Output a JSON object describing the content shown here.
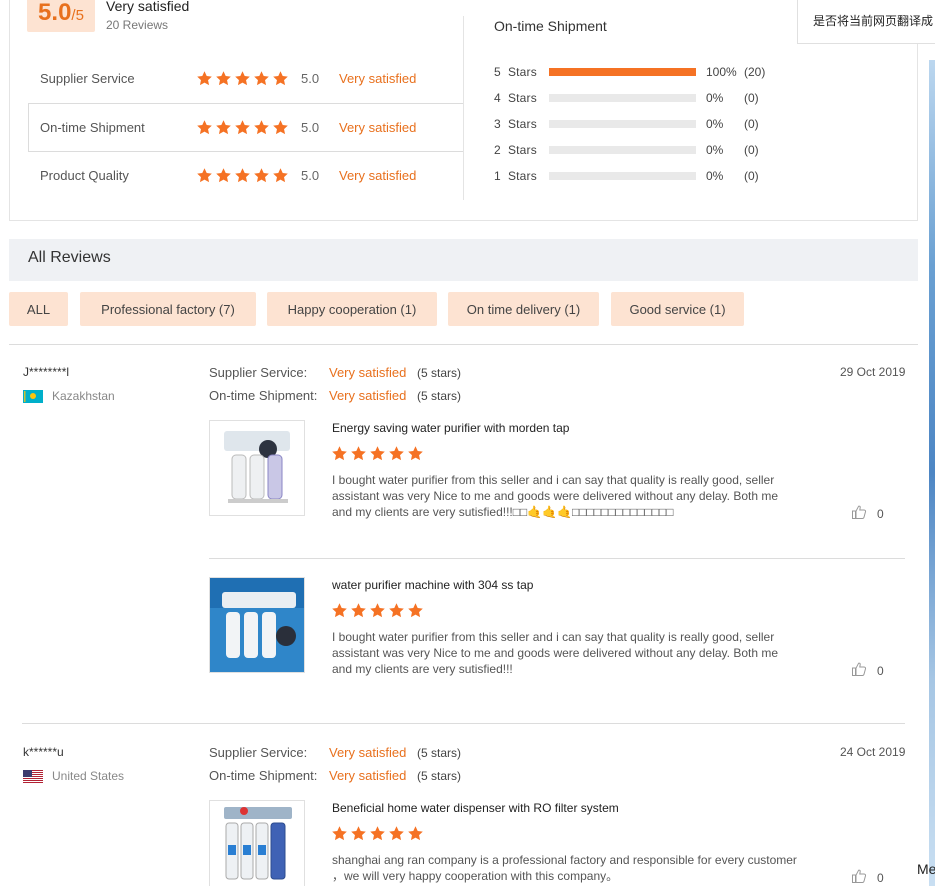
{
  "summary": {
    "score": "5.0",
    "score_max": "/5",
    "headline": "Very satisfied",
    "reviews_count": "20 Reviews",
    "categories": [
      {
        "label": "Supplier Service",
        "value": "5.0",
        "text": "Very satisfied",
        "stars": 5
      },
      {
        "label": "On-time Shipment",
        "value": "5.0",
        "text": "Very satisfied",
        "stars": 5
      },
      {
        "label": "Product Quality",
        "value": "5.0",
        "text": "Very satisfied",
        "stars": 5
      }
    ],
    "distribution_title": "On-time Shipment",
    "distribution": [
      {
        "label": "5  Stars",
        "pct": "100%",
        "count": "(20)",
        "fraction": 1.0
      },
      {
        "label": "4  Stars",
        "pct": "0%",
        "count": "(0)",
        "fraction": 0
      },
      {
        "label": "3  Stars",
        "pct": "0%",
        "count": "(0)",
        "fraction": 0
      },
      {
        "label": "2  Stars",
        "pct": "0%",
        "count": "(0)",
        "fraction": 0
      },
      {
        "label": "1  Stars",
        "pct": "0%",
        "count": "(0)",
        "fraction": 0
      }
    ]
  },
  "translate_popup": "是否将当前网页翻译成",
  "all_reviews": {
    "title": "All Reviews",
    "filters": [
      "ALL",
      "Professional factory (7)",
      "Happy cooperation (1)",
      "On time delivery (1)",
      "Good service (1)"
    ]
  },
  "reviews": [
    {
      "name": "J********l",
      "country": "Kazakhstan",
      "date": "29 Oct 2019",
      "meta": [
        {
          "key": "Supplier Service:",
          "value": "Very satisfied",
          "stars": "(5 stars)"
        },
        {
          "key": "On-time Shipment:",
          "value": "Very satisfied",
          "stars": "(5 stars)"
        }
      ],
      "items": [
        {
          "title": "Energy saving water purifier with morden tap",
          "stars": 5,
          "text": "I bought water purifier from this seller and i can say that quality is really good, seller assistant was very Nice to me and goods were delivered without any delay. Both me and my clients are very sutisfied!!!□□🤙🤙🤙□□□□□□□□□□□□□□",
          "likes": "0"
        },
        {
          "title": "water purifier machine with 304 ss tap",
          "stars": 5,
          "text": "I bought water purifier from this seller and i can say that quality is really good, seller assistant was very Nice to me and goods were delivered without any delay. Both me and my clients are very sutisfied!!!",
          "likes": "0"
        }
      ]
    },
    {
      "name": "k******u",
      "country": "United States",
      "date": "24 Oct 2019",
      "meta": [
        {
          "key": "Supplier Service:",
          "value": "Very satisfied",
          "stars": "(5 stars)"
        },
        {
          "key": "On-time Shipment:",
          "value": "Very satisfied",
          "stars": "(5 stars)"
        }
      ],
      "items": [
        {
          "title": "Beneficial home water dispenser with RO filter system",
          "stars": 5,
          "text": "shanghai ang ran company is a professional factory and responsible for every customer ，we will very happy cooperation with this company。",
          "likes": "0"
        }
      ]
    }
  ],
  "corner_text": "Me",
  "colors": {
    "accent": "#e8701d",
    "star": "#f57224",
    "tag_bg": "#fde3d2"
  },
  "icons": [
    "star-icon",
    "thumbs-up-icon",
    "kazakhstan-flag-icon",
    "us-flag-icon"
  ]
}
